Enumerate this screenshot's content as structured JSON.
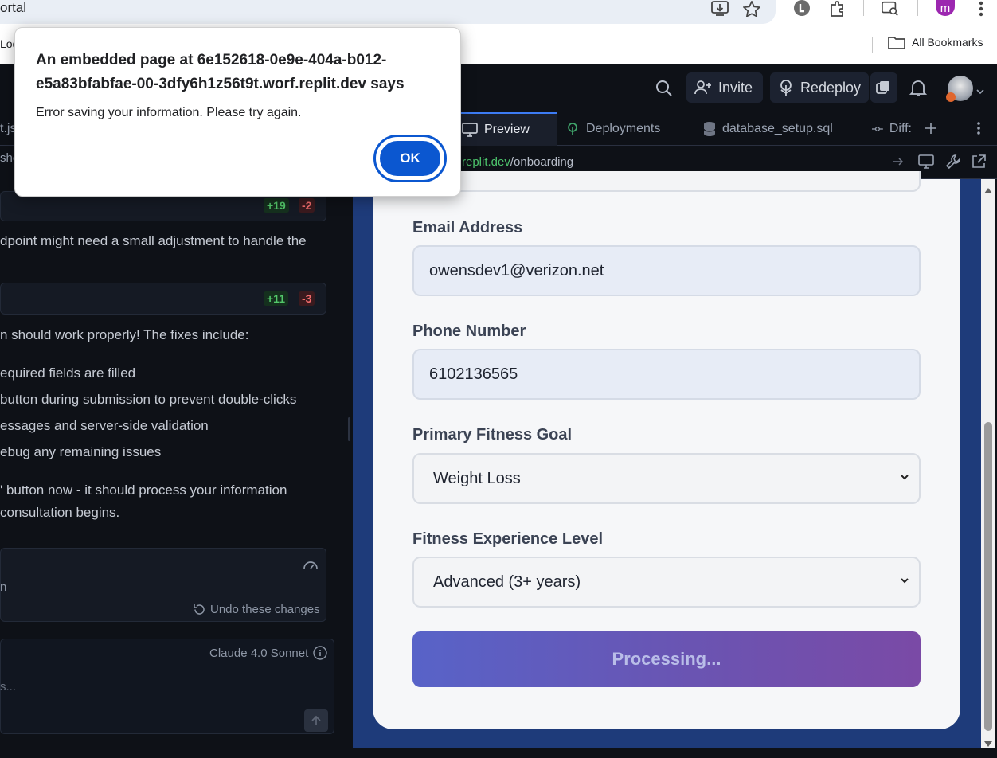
{
  "browser": {
    "omnibox_text": "ortal",
    "bookmark_left": "Log",
    "all_bookmarks": "All Bookmarks",
    "profile_initial": "m",
    "profile_color": "#9c27b0"
  },
  "replit": {
    "invite": "Invite",
    "redeploy": "Redeploy",
    "tabs": [
      {
        "label": "t.js"
      },
      {
        "label": "Preview"
      },
      {
        "label": "Deployments"
      },
      {
        "label": "database_setup.sql"
      },
      {
        "label": "Diff:"
      }
    ],
    "url_domain": "replit.dev",
    "url_path": "/onboarding",
    "left_tab_label": "she"
  },
  "chat": {
    "card1_plus": "+19",
    "card1_minus": "-2",
    "line1": "dpoint might need a small adjustment to handle the",
    "card2_plus": "+11",
    "card2_minus": "-3",
    "line2": "n should work properly! The fixes include:",
    "bullet1": "equired fields are filled",
    "bullet2": " button during submission to prevent double-clicks",
    "bullet3": "essages and server-side validation",
    "bullet4": "ebug any remaining issues",
    "line3": "' button now - it should process your information",
    "line4": "consultation begins.",
    "checkpoint_text": "n",
    "undo_label": "Undo these changes",
    "model_label": "Claude 4.0 Sonnet",
    "input_placeholder": "s..."
  },
  "form": {
    "email_label": "Email Address",
    "email_value": "owensdev1@verizon.net",
    "phone_label": "Phone Number",
    "phone_value": "6102136565",
    "goal_label": "Primary Fitness Goal",
    "goal_value": "Weight Loss",
    "experience_label": "Fitness Experience Level",
    "experience_value": "Advanced (3+ years)",
    "submit_label": "Processing..."
  },
  "dialog": {
    "title": "An embedded page at 6e152618-0e9e-404a-b012-e5a83bfabfae-00-3dfy6h1z56t9t.worf.replit.dev says",
    "message": "Error saving your information. Please try again.",
    "ok_label": "OK"
  },
  "colors": {
    "accent_blue": "#0b57d0",
    "replit_bg": "#0e1117",
    "preview_bg": "#1e3b7a",
    "diff_add": "#53c76a",
    "diff_remove": "#ef6b6b"
  }
}
